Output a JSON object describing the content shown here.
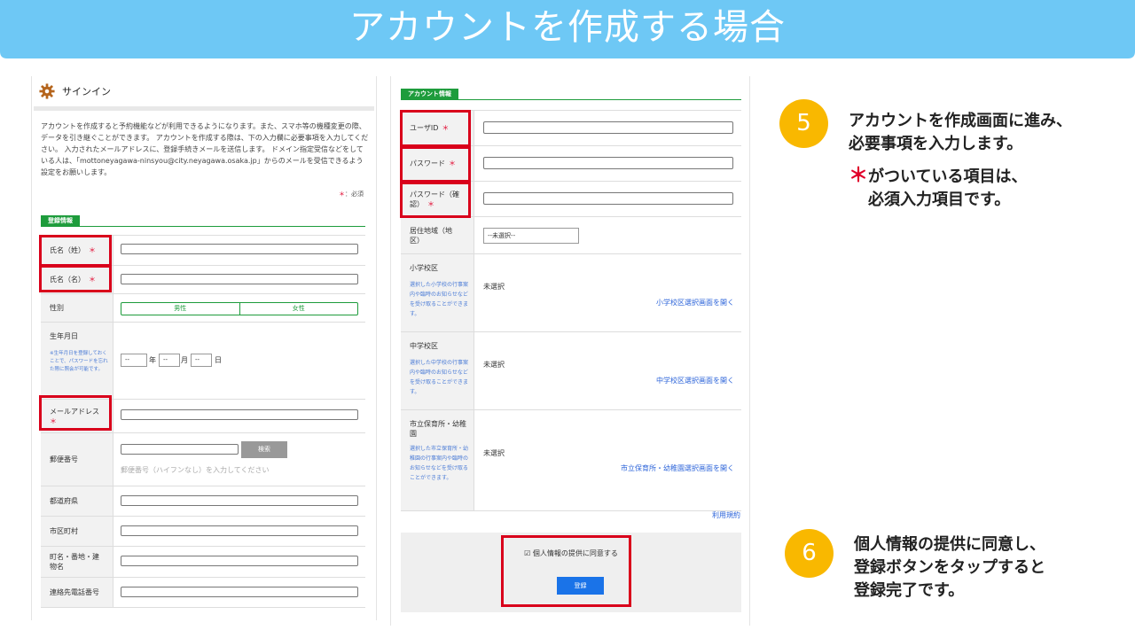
{
  "banner": {
    "title": "アカウントを作成する場合",
    "color": "#6ec8f5"
  },
  "left": {
    "signin_title": "サインイン",
    "intro": "アカウントを作成すると予約機能などが利用できるようになります。また、スマホ等の機種変更の際、データを引き継ぐことができます。 アカウントを作成する際は、下の入力欄に必要事項を入力してください。 入力されたメールアドレスに、登録手続きメールを送信します。 ドメイン指定受信などをしている人は、「mottoneyagawa-ninsyou@city.neyagawa.osaka.jp」からのメールを受信できるよう設定をお願いします。",
    "required_mark": "＊",
    "required_note": "：必須",
    "section": "登録情報",
    "fields": {
      "last_name": "氏名（姓）",
      "first_name": "氏名（名）",
      "gender": "性別",
      "gender_male": "男性",
      "gender_female": "女性",
      "birthday": "生年月日",
      "birthday_note": "※生年月日を登録しておくことで、パスワードを忘れた際に照会が可能です。",
      "date_placeholder": "--",
      "year": "年",
      "month": "月",
      "day": "日",
      "email": "メールアドレス",
      "postal": "郵便番号",
      "search_button": "検索",
      "postal_hint": "郵便番号（ハイフンなし）を入力してください",
      "prefecture": "都道府県",
      "city": "市区町村",
      "address": "町名・番地・建物名",
      "phone": "連絡先電話番号"
    }
  },
  "mid": {
    "section": "アカウント情報",
    "user_id": "ユーザID",
    "password": "パスワード",
    "password_confirm": "パスワード（確認）",
    "area": "居住地域（地区）",
    "area_select": "--未選択--",
    "elementary": "小学校区",
    "elementary_note": "選択した小学校の行事案内や臨時のお知らせなどを受け取ることができます。",
    "middle": "中学校区",
    "middle_note": "選択した中学校の行事案内や臨時のお知らせなどを受け取ることができます。",
    "nursery": "市立保育所・幼稚園",
    "nursery_note": "選択した市立保育所・幼稚園の行事案内や臨時のお知らせなどを受け取ることができます。",
    "unselected": "未選択",
    "elementary_link": "小学校区選択画面を開く",
    "middle_link": "中学校区選択画面を開く",
    "nursery_link": "市立保育所・幼稚園選択画面を開く",
    "terms": "利用規約",
    "consent": "☑ 個人情報の提供に同意する",
    "register": "登録"
  },
  "steps": {
    "step5_num": "5",
    "step5_line1": "アカウントを作成画面に進み、",
    "step5_line2": "必要事項を入力します。",
    "step5_note_mark": "＊",
    "step5_note1": "がついている項目は、",
    "step5_note2": "必須入力項目です。",
    "step6_num": "6",
    "step6_line1": "個人情報の提供に同意し、",
    "step6_line2": "登録ボタンをタップすると",
    "step6_line3": "登録完了です。"
  },
  "colors": {
    "accent_green": "#1e9c3c",
    "highlight_red": "#d9001b",
    "step_yellow": "#f9b800",
    "link_blue": "#2b63d9"
  }
}
